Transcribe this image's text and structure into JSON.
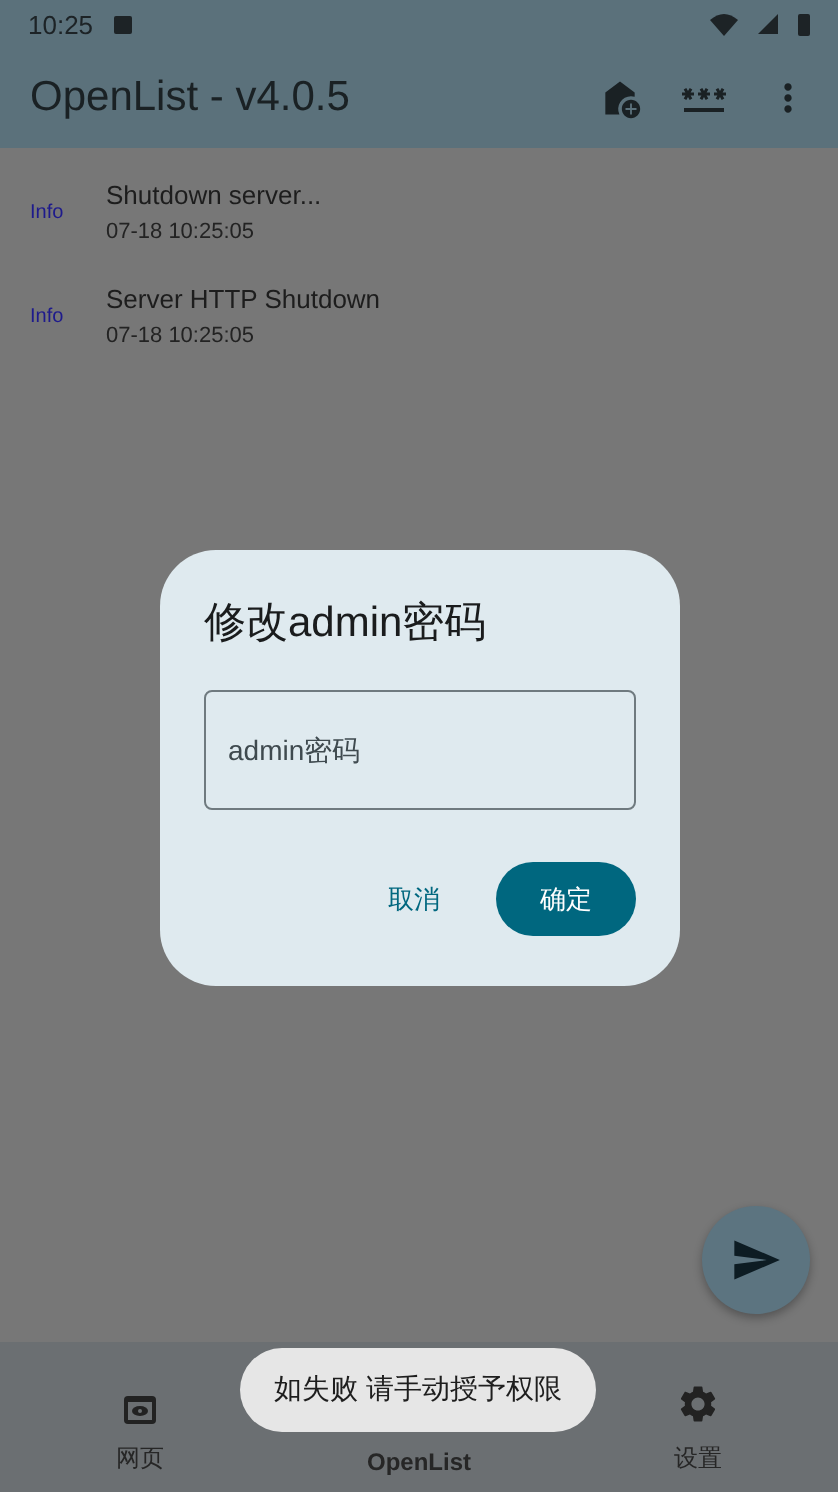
{
  "status_bar": {
    "time": "10:25"
  },
  "app_bar": {
    "title": "OpenList - v4.0.5"
  },
  "logs": [
    {
      "level": "Info",
      "message": "Shutdown server...",
      "time": "07-18 10:25:05"
    },
    {
      "level": "Info",
      "message": "Server HTTP Shutdown",
      "time": "07-18 10:25:05"
    }
  ],
  "dialog": {
    "title": "修改admin密码",
    "field": {
      "placeholder": "admin密码"
    },
    "buttons": [
      {
        "label": "取消",
        "kind": "text"
      },
      {
        "label": "确定",
        "kind": "filled"
      }
    ]
  },
  "nav": [
    {
      "label": "网页",
      "selected": false
    },
    {
      "label": "OpenList",
      "selected": true
    },
    {
      "label": "设置",
      "selected": false
    }
  ],
  "toast": "如失败 请手动授予权限"
}
